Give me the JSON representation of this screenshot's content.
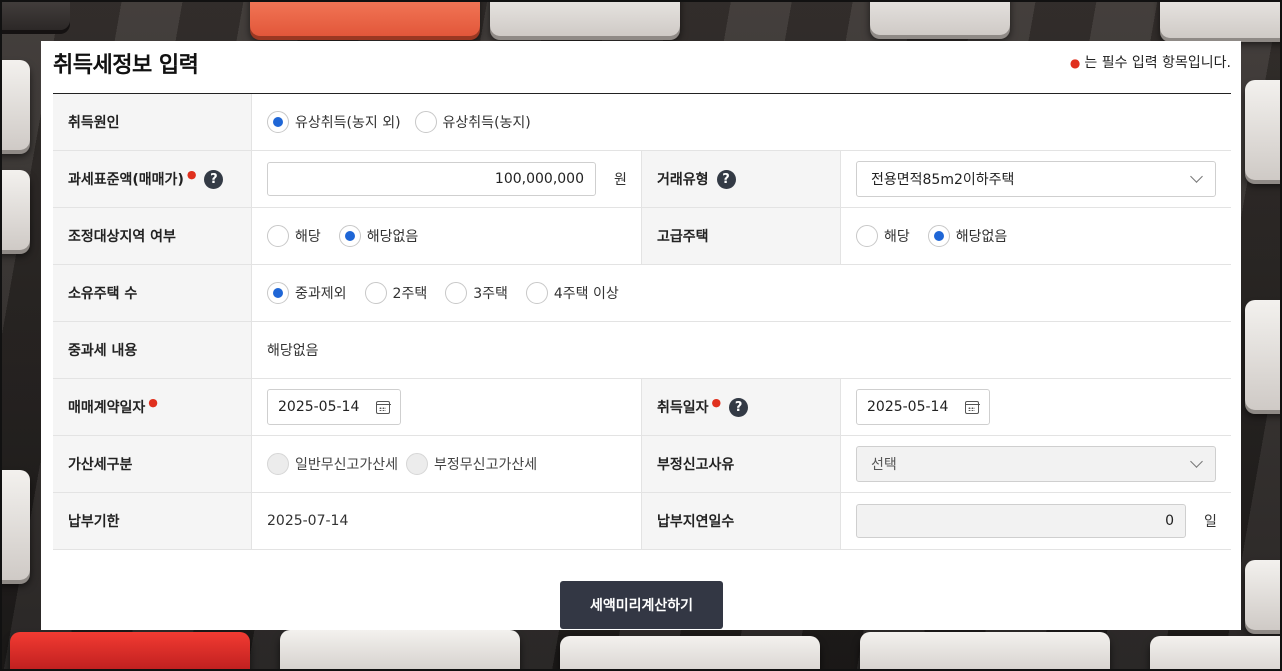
{
  "page": {
    "title": "취득세정보 입력",
    "required_note": "는 필수 입력 항목입니다."
  },
  "form": {
    "acquisition_cause": {
      "label": "취득원인",
      "options": [
        "유상취득(농지 외)",
        "유상취득(농지)"
      ],
      "selected": "유상취득(농지 외)"
    },
    "tax_base": {
      "label": "과세표준액(매매가)",
      "value": "100,000,000",
      "unit": "원"
    },
    "transaction_type": {
      "label": "거래유형",
      "value": "전용면적85m2이하주택"
    },
    "regulated_area": {
      "label": "조정대상지역 여부",
      "options": [
        "해당",
        "해당없음"
      ],
      "selected": "해당없음"
    },
    "luxury_house": {
      "label": "고급주택",
      "options": [
        "해당",
        "해당없음"
      ],
      "selected": "해당없음"
    },
    "houses_owned": {
      "label": "소유주택 수",
      "options": [
        "중과제외",
        "2주택",
        "3주택",
        "4주택 이상"
      ],
      "selected": "중과제외"
    },
    "heavy_tax": {
      "label": "중과세 내용",
      "value": "해당없음"
    },
    "contract_date": {
      "label": "매매계약일자",
      "value": "2025-05-14"
    },
    "acquisition_date": {
      "label": "취득일자",
      "value": "2025-05-14"
    },
    "additional_tax": {
      "label": "가산세구분",
      "options": [
        "일반무신고가산세",
        "부정무신고가산세"
      ]
    },
    "fraud_reason": {
      "label": "부정신고사유",
      "value": "선택"
    },
    "payment_deadline": {
      "label": "납부기한",
      "value": "2025-07-14"
    },
    "late_days": {
      "label": "납부지연일수",
      "value": "0",
      "unit": "일"
    }
  },
  "actions": {
    "calculate_label": "세액미리계산하기"
  },
  "colors": {
    "accent": "#1f66d6",
    "required": "#e0301e",
    "button": "#333744"
  }
}
